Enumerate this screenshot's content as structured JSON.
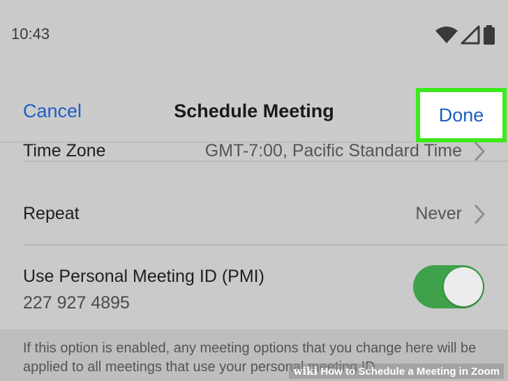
{
  "status_bar": {
    "time": "10:43",
    "icons": [
      "wifi-icon",
      "cellular-signal-icon",
      "battery-icon"
    ]
  },
  "nav": {
    "cancel_label": "Cancel",
    "title": "Schedule Meeting",
    "done_label": "Done",
    "highlight_color": "#3dea1c",
    "link_color": "#1e5fc4"
  },
  "settings": {
    "time_zone": {
      "label": "Time Zone",
      "value": "GMT-7:00, Pacific Standard Time"
    },
    "repeat": {
      "label": "Repeat",
      "value": "Never"
    },
    "pmi": {
      "label": "Use Personal Meeting ID (PMI)",
      "number": "227 927 4895",
      "toggle_on": true,
      "toggle_color": "#3fa14a"
    }
  },
  "footer": {
    "note": "If this option is enabled, any meeting options that you change here will be applied to all meetings that use your personal meeting ID."
  },
  "watermark": {
    "brand": "wiki",
    "text": "How to Schedule a Meeting in Zoom"
  }
}
